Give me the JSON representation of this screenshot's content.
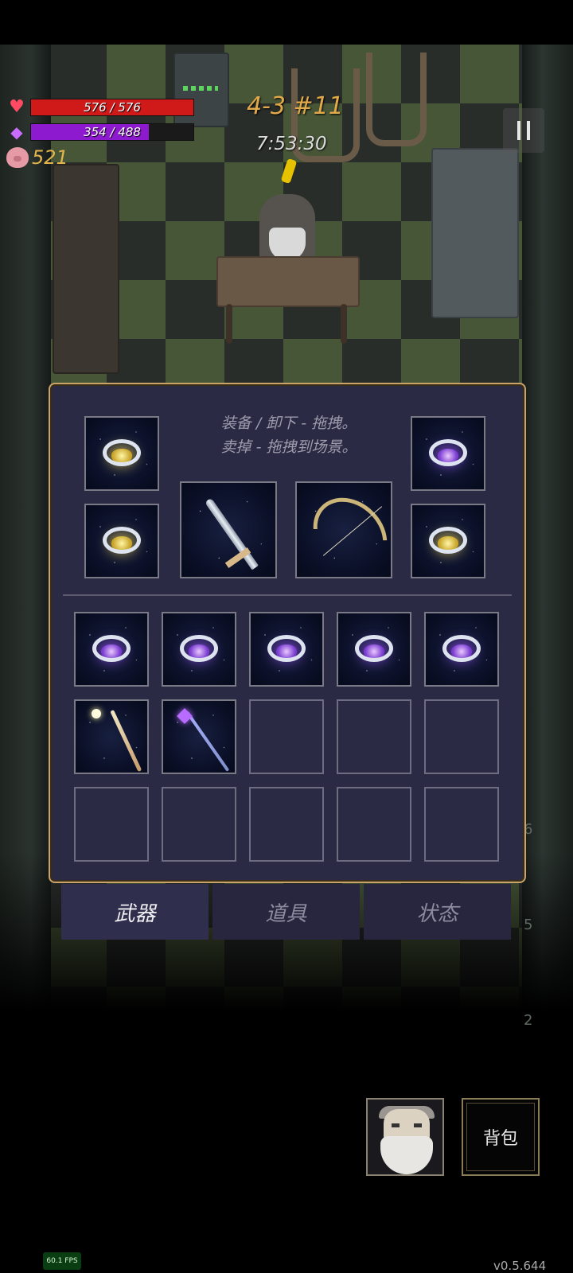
{
  "hud": {
    "hp_text": "576 / 576",
    "hp_fraction": 1.0,
    "mp_text": "354 / 488",
    "mp_fraction": 0.725,
    "coins": "521",
    "level": "4-3 #11",
    "timer": "7:53:30"
  },
  "inventory": {
    "hint_line1": "装备 / 卸下 - 拖拽。",
    "hint_line2": "卖掉 - 拖拽到场景。",
    "equipped": [
      {
        "type": "ring",
        "gem": "gold"
      },
      {
        "type": "ring",
        "gem": "purple"
      },
      {
        "type": "ring",
        "gem": "gold"
      },
      {
        "type": "ring",
        "gem": "gold"
      },
      {
        "type": "sword"
      },
      {
        "type": "bow"
      }
    ],
    "grid": [
      "ring-purple",
      "ring-purple",
      "ring-purple",
      "ring-purple",
      "ring-purple",
      "staff-gold",
      "staff-purple",
      "empty",
      "empty",
      "empty",
      "empty",
      "empty",
      "empty",
      "empty",
      "empty"
    ]
  },
  "tabs": [
    {
      "label": "武器",
      "active": true
    },
    {
      "label": "道具",
      "active": false
    },
    {
      "label": "状态",
      "active": false
    }
  ],
  "side_counts": [
    "6",
    "5",
    "2"
  ],
  "bag_label": "背包",
  "fps": "60.1 FPS",
  "version": "v0.5.644",
  "colors": {
    "hp": "#d01a1a",
    "mp": "#8e1ad0",
    "coin": "#e2b44b",
    "panel_border": "#c9a36a",
    "panel_bg": "#2b2a44"
  },
  "icons": [
    "heart-icon",
    "mana-gem-icon",
    "pig-icon",
    "pause-icon"
  ]
}
